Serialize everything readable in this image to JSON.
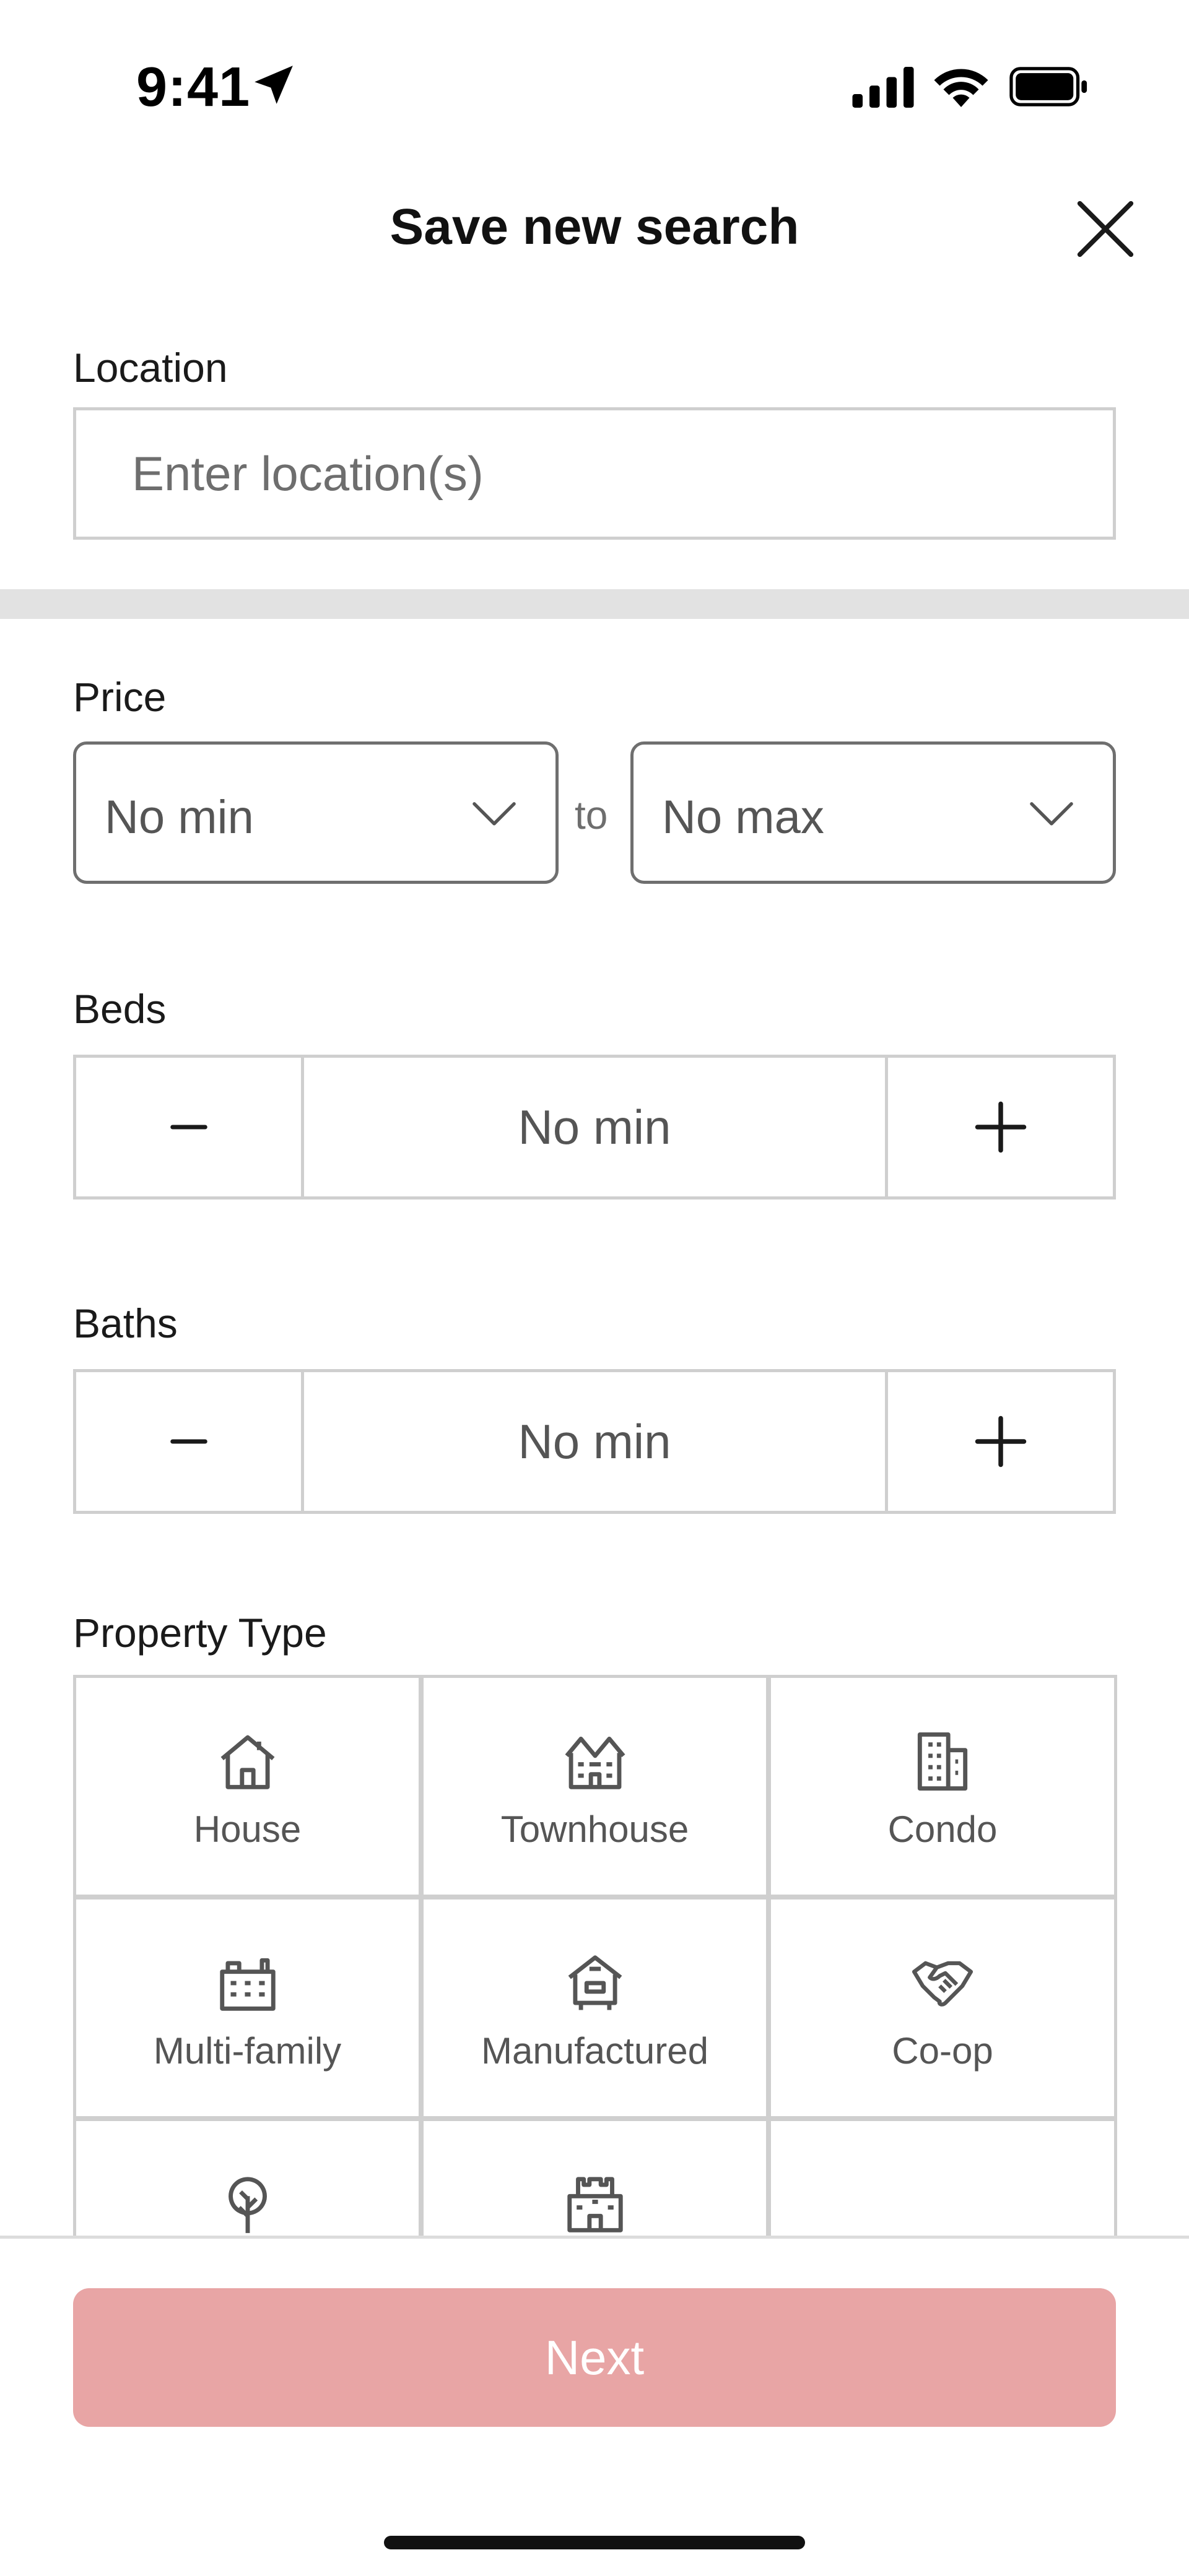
{
  "status_bar": {
    "time": "9:41"
  },
  "header": {
    "title": "Save new search"
  },
  "location": {
    "label": "Location",
    "placeholder": "Enter location(s)",
    "value": ""
  },
  "price": {
    "label": "Price",
    "min_value": "No min",
    "connector": "to",
    "max_value": "No max"
  },
  "beds": {
    "label": "Beds",
    "value": "No min"
  },
  "baths": {
    "label": "Baths",
    "value": "No min"
  },
  "property_type": {
    "label": "Property Type",
    "items": [
      {
        "label": "House",
        "icon": "house-icon"
      },
      {
        "label": "Townhouse",
        "icon": "townhouse-icon"
      },
      {
        "label": "Condo",
        "icon": "condo-icon"
      },
      {
        "label": "Multi-family",
        "icon": "multi-family-icon"
      },
      {
        "label": "Manufactured",
        "icon": "manufactured-icon"
      },
      {
        "label": "Co-op",
        "icon": "co-op-icon"
      },
      {
        "label": "",
        "icon": "land-icon"
      },
      {
        "label": "",
        "icon": "other-building-icon"
      }
    ]
  },
  "footer": {
    "next_label": "Next"
  },
  "colors": {
    "next_button_disabled": "#e8a5a5",
    "border": "#cfcfcf",
    "divider": "#e2e2e2"
  }
}
